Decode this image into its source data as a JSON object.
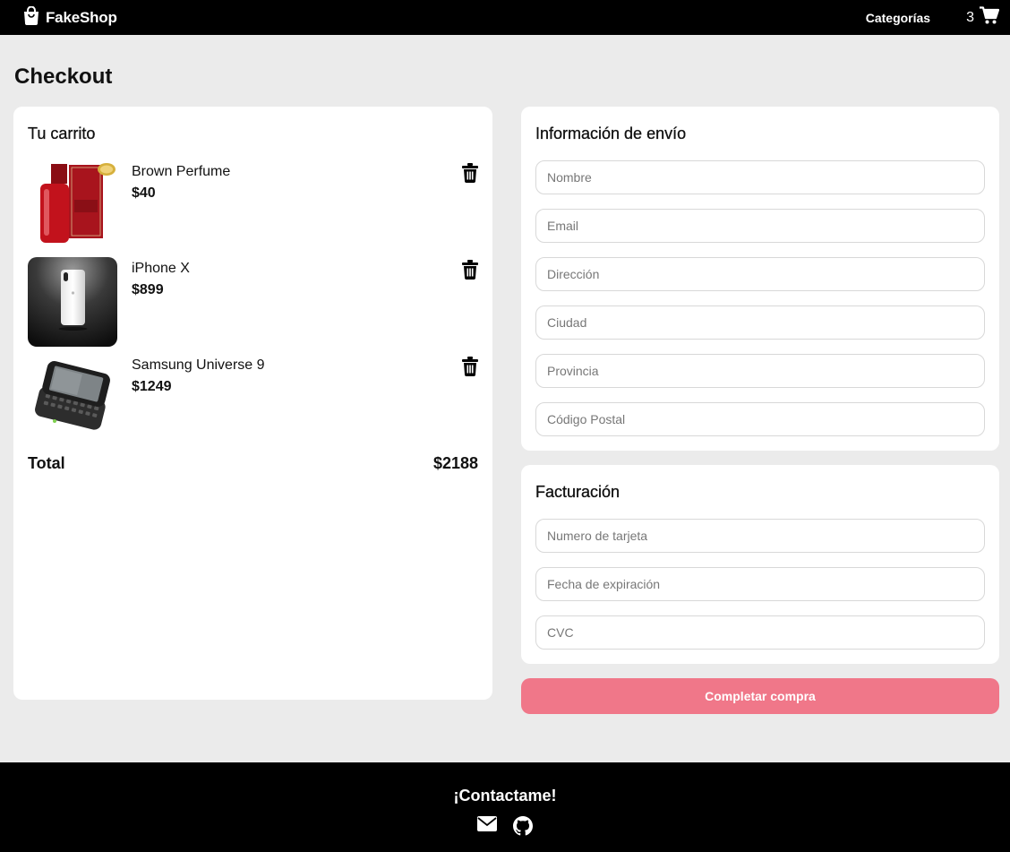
{
  "navbar": {
    "brand": "FakeShop",
    "brand_icon": "shopping-bag-icon",
    "categories_label": "Categorías",
    "cart_count": "3",
    "cart_icon": "cart-icon"
  },
  "page": {
    "title": "Checkout"
  },
  "cart": {
    "title": "Tu carrito",
    "items": [
      {
        "name": "Brown Perfume",
        "price": "$40",
        "icon": "trash-icon"
      },
      {
        "name": "iPhone X",
        "price": "$899",
        "icon": "trash-icon"
      },
      {
        "name": "Samsung Universe 9",
        "price": "$1249",
        "icon": "trash-icon"
      }
    ],
    "total_label": "Total",
    "total_value": "$2188"
  },
  "shipping": {
    "title": "Información de envío",
    "fields": [
      {
        "placeholder": "Nombre",
        "value": ""
      },
      {
        "placeholder": "Email",
        "value": ""
      },
      {
        "placeholder": "Dirección",
        "value": ""
      },
      {
        "placeholder": "Ciudad",
        "value": ""
      },
      {
        "placeholder": "Provincia",
        "value": ""
      },
      {
        "placeholder": "Código Postal",
        "value": ""
      }
    ]
  },
  "billing": {
    "title": "Facturación",
    "fields": [
      {
        "placeholder": "Numero de tarjeta",
        "value": ""
      },
      {
        "placeholder": "Fecha de expiración",
        "value": ""
      },
      {
        "placeholder": "CVC",
        "value": ""
      }
    ]
  },
  "submit_label": "Completar compra",
  "footer": {
    "title": "¡Contactame!",
    "icons": [
      "mail-icon",
      "github-icon"
    ]
  },
  "colors": {
    "navbar_bg": "#000000",
    "page_bg": "#ebebeb",
    "accent": "#f07789",
    "card_bg": "#ffffff"
  }
}
